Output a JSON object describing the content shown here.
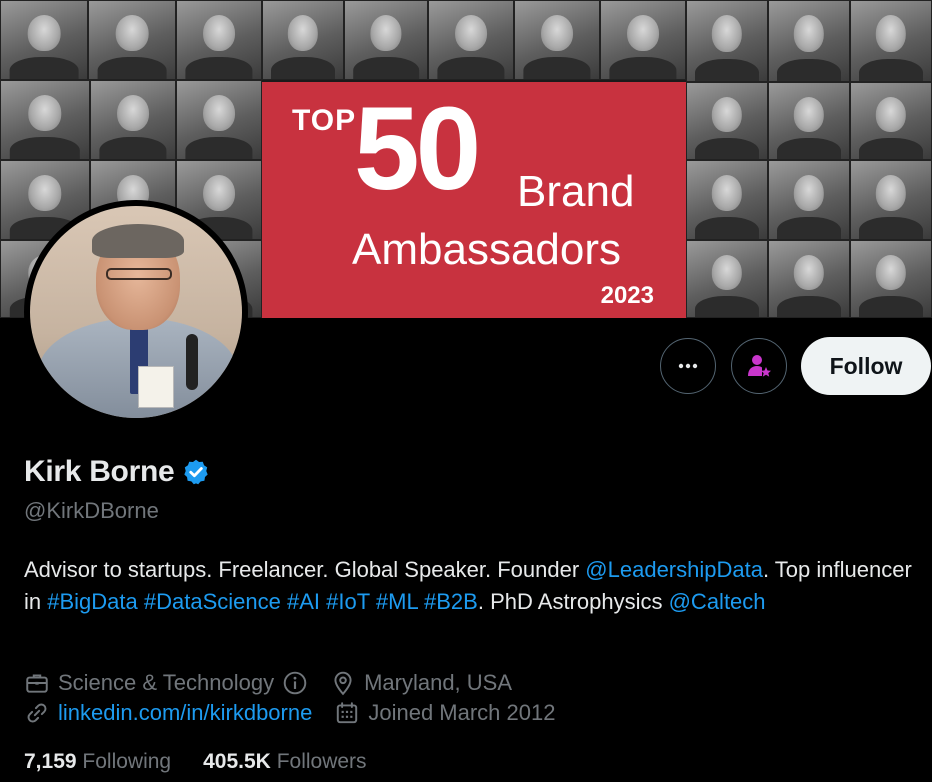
{
  "banner": {
    "card": {
      "top": "TOP",
      "number": "50",
      "line1": "Brand",
      "line2": "Ambassadors",
      "year": "2023",
      "color": "#c8323f"
    }
  },
  "actions": {
    "more_icon": "more-horizontal-icon",
    "subscribe_icon": "person-star-icon",
    "follow_label": "Follow"
  },
  "profile": {
    "name": "Kirk Borne",
    "verified_icon": "verified-badge-icon",
    "handle": "@KirkDBorne"
  },
  "bio": [
    {
      "text": "Advisor to startups. Freelancer. Global Speaker. Founder ",
      "type": "text"
    },
    {
      "text": "@LeadershipData",
      "type": "link"
    },
    {
      "text": ". Top influencer in ",
      "type": "text"
    },
    {
      "text": "#BigData",
      "type": "link"
    },
    {
      "text": " ",
      "type": "text"
    },
    {
      "text": "#DataScience",
      "type": "link"
    },
    {
      "text": " ",
      "type": "text"
    },
    {
      "text": "#AI",
      "type": "link"
    },
    {
      "text": " ",
      "type": "text"
    },
    {
      "text": "#IoT",
      "type": "link"
    },
    {
      "text": " ",
      "type": "text"
    },
    {
      "text": "#ML",
      "type": "link"
    },
    {
      "text": " ",
      "type": "text"
    },
    {
      "text": "#B2B",
      "type": "link"
    },
    {
      "text": ". PhD Astrophysics ",
      "type": "text"
    },
    {
      "text": "@Caltech",
      "type": "link"
    }
  ],
  "meta": {
    "category": "Science & Technology",
    "location": "Maryland, USA",
    "website": "linkedin.com/in/kirkdborne",
    "joined": "Joined March 2012"
  },
  "stats": {
    "following_count": "7,159",
    "following_label": "Following",
    "followers_count": "405.5K",
    "followers_label": "Followers"
  },
  "colors": {
    "accent": "#1d9bf0",
    "subscribe": "#c936cc",
    "muted": "#71767b"
  }
}
